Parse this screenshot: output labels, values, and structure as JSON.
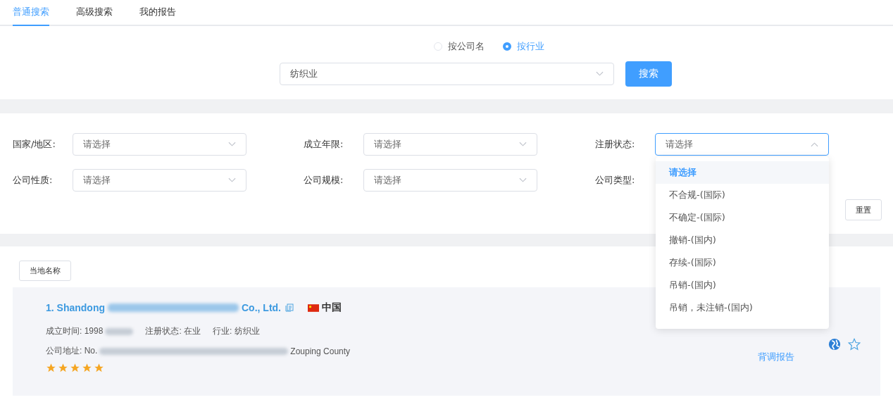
{
  "tabs": [
    {
      "label": "普通搜索",
      "selected": true
    },
    {
      "label": "高级搜索",
      "selected": false
    },
    {
      "label": "我的报告",
      "selected": false
    }
  ],
  "search": {
    "modes": [
      {
        "label": "按公司名",
        "selected": false
      },
      {
        "label": "按行业",
        "selected": true
      }
    ],
    "value": "纺织业",
    "button": "搜索"
  },
  "filters": [
    {
      "label": "国家/地区:",
      "placeholder": "请选择",
      "open": false
    },
    {
      "label": "成立年限:",
      "placeholder": "请选择",
      "open": false
    },
    {
      "label": "注册状态:",
      "placeholder": "请选择",
      "open": true
    },
    {
      "label": "公司性质:",
      "placeholder": "请选择",
      "open": false
    },
    {
      "label": "公司规模:",
      "placeholder": "请选择",
      "open": false
    },
    {
      "label": "公司类型:"
    }
  ],
  "dropdown": {
    "options": [
      {
        "label": "请选择",
        "selected": true
      },
      {
        "label": "不合规-(国际)",
        "selected": false
      },
      {
        "label": "不确定-(国际)",
        "selected": false
      },
      {
        "label": "撤销-(国内)",
        "selected": false
      },
      {
        "label": "存续-(国际)",
        "selected": false
      },
      {
        "label": "吊销-(国内)",
        "selected": false
      },
      {
        "label": "吊销，未注销-(国内)",
        "selected": false
      }
    ]
  },
  "reset_button": "重置",
  "results": {
    "sort_button": "当地名称",
    "items": [
      {
        "name_start": "1. Shandong",
        "name_end": "Co., Ltd.",
        "country": "中国",
        "founded": "成立时间: 1998",
        "status": "注册状态: 在业",
        "industry": "行业: 纺织业",
        "address_start": "公司地址: No.",
        "address_end": "Zouping County",
        "stars": 5,
        "report_link": "背调报告"
      }
    ]
  }
}
